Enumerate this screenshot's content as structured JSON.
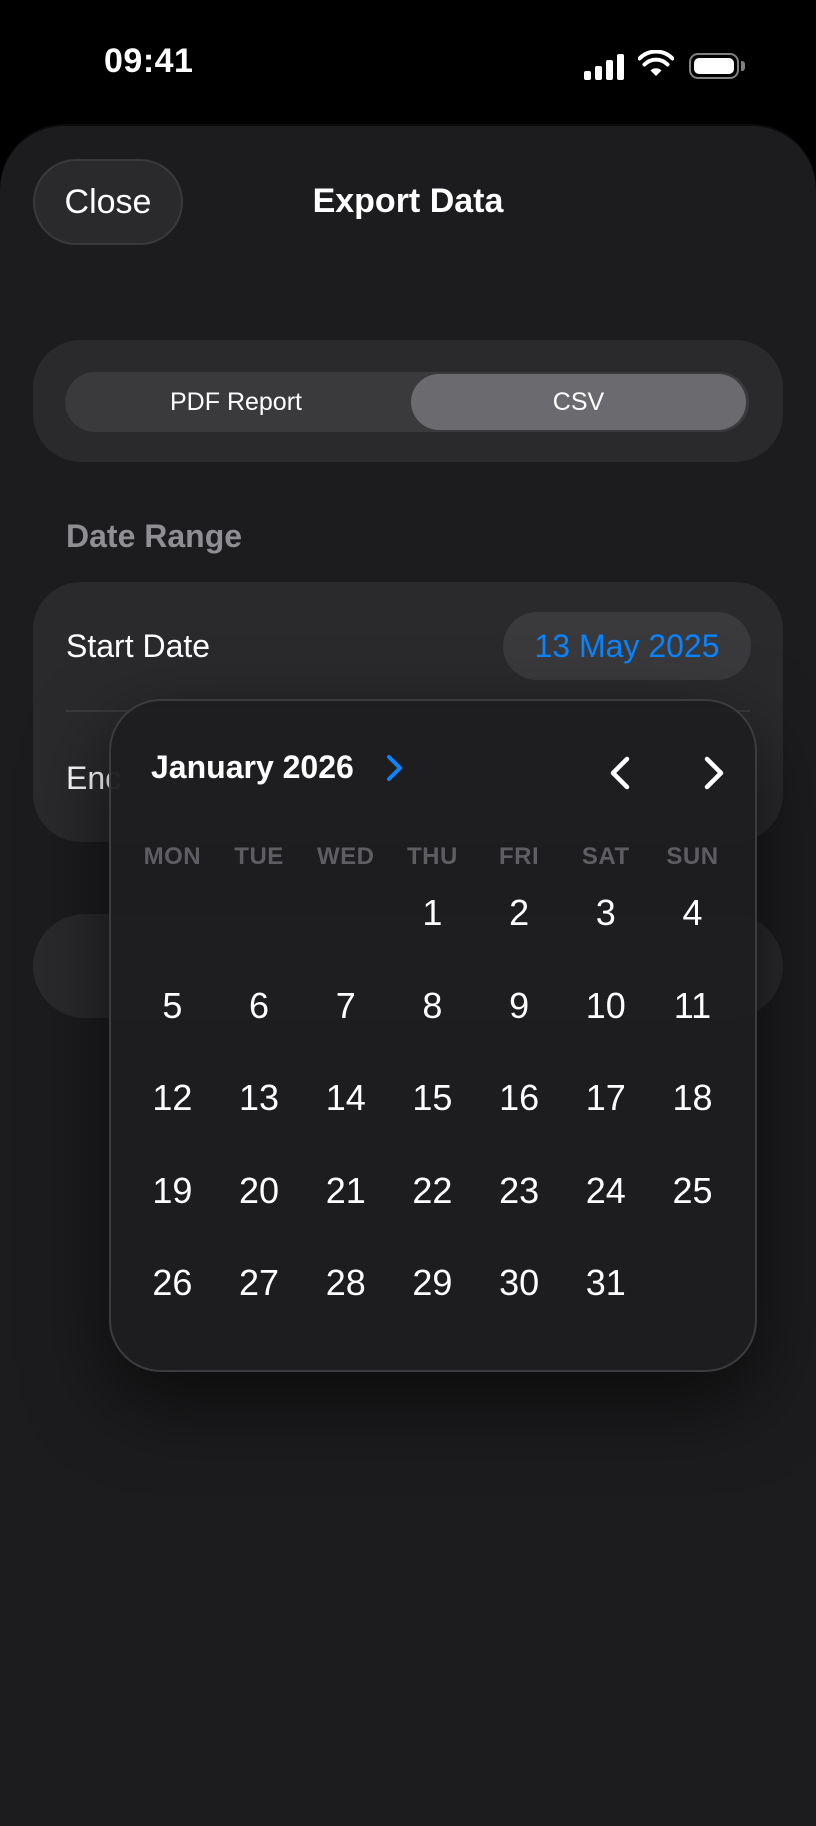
{
  "status": {
    "time": "09:41"
  },
  "header": {
    "close_label": "Close",
    "title": "Export Data"
  },
  "format": {
    "options": [
      "PDF Report",
      "CSV"
    ],
    "selected": "CSV"
  },
  "date_range": {
    "section_label": "Date Range",
    "start_label": "Start Date",
    "start_value": "13 May 2025",
    "end_label_visible": "Enc"
  },
  "picker": {
    "month_label": "January 2026",
    "weekdays": [
      "MON",
      "TUE",
      "WED",
      "THU",
      "FRI",
      "SAT",
      "SUN"
    ],
    "first_weekday_index": 3,
    "days": [
      "1",
      "2",
      "3",
      "4",
      "5",
      "6",
      "7",
      "8",
      "9",
      "10",
      "11",
      "12",
      "13",
      "14",
      "15",
      "16",
      "17",
      "18",
      "19",
      "20",
      "21",
      "22",
      "23",
      "24",
      "25",
      "26",
      "27",
      "28",
      "29",
      "30",
      "31"
    ]
  },
  "colors": {
    "accent": "#0a84ff",
    "sheet": "#1c1c1e",
    "card": "#2a2a2d"
  },
  "icons": [
    "signal-icon",
    "wifi-icon",
    "battery-icon",
    "chevron-right-icon",
    "chevron-left-icon"
  ]
}
